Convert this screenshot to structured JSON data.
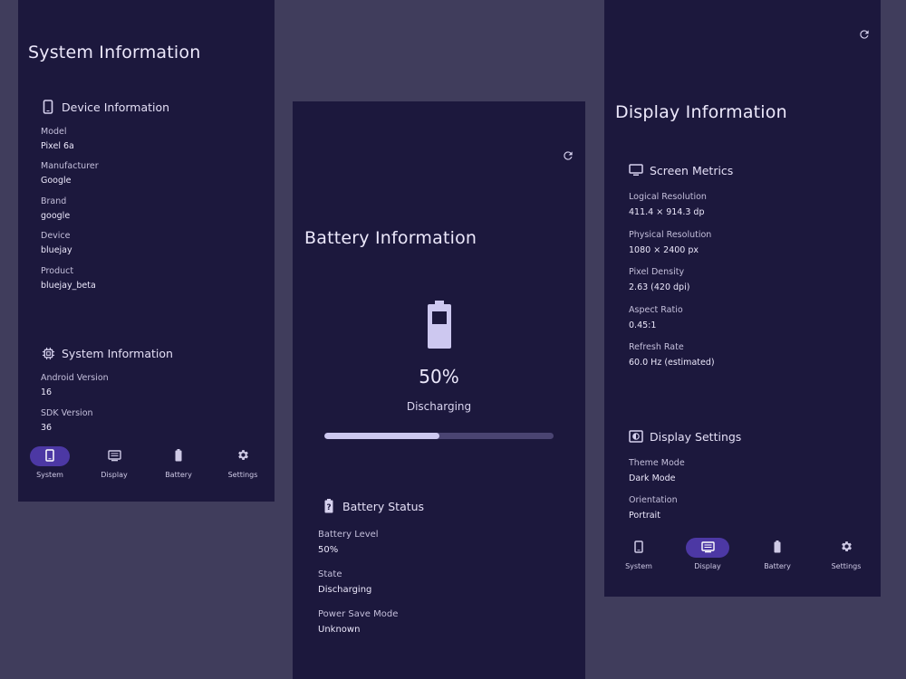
{
  "system_screen": {
    "title": "System Information",
    "device_section": {
      "title": "Device Information",
      "icon": "phone-icon",
      "fields": [
        {
          "label": "Model",
          "value": "Pixel 6a"
        },
        {
          "label": "Manufacturer",
          "value": "Google"
        },
        {
          "label": "Brand",
          "value": "google"
        },
        {
          "label": "Device",
          "value": "bluejay"
        },
        {
          "label": "Product",
          "value": "bluejay_beta"
        }
      ]
    },
    "system_section": {
      "title": "System Information",
      "icon": "chip-icon",
      "fields": [
        {
          "label": "Android Version",
          "value": "16"
        },
        {
          "label": "SDK Version",
          "value": "36"
        }
      ]
    },
    "nav": {
      "items": [
        {
          "label": "System",
          "icon": "phone-icon",
          "active": true
        },
        {
          "label": "Display",
          "icon": "display-icon",
          "active": false
        },
        {
          "label": "Battery",
          "icon": "battery-icon",
          "active": false
        },
        {
          "label": "Settings",
          "icon": "gear-icon",
          "active": false
        }
      ]
    }
  },
  "battery_screen": {
    "title": "Battery Information",
    "refresh_icon": "refresh-icon",
    "level_text": "50%",
    "level_fraction": 0.5,
    "state_text": "Discharging",
    "status_section": {
      "title": "Battery Status",
      "icon": "battery-unknown-icon",
      "fields": [
        {
          "label": "Battery Level",
          "value": "50%"
        },
        {
          "label": "State",
          "value": "Discharging"
        },
        {
          "label": "Power Save Mode",
          "value": "Unknown"
        }
      ]
    }
  },
  "display_screen": {
    "title": "Display Information",
    "refresh_icon": "refresh-icon",
    "metrics_section": {
      "title": "Screen Metrics",
      "icon": "monitor-icon",
      "fields": [
        {
          "label": "Logical Resolution",
          "value": "411.4 × 914.3 dp"
        },
        {
          "label": "Physical Resolution",
          "value": "1080 × 2400 px"
        },
        {
          "label": "Pixel Density",
          "value": "2.63 (420 dpi)"
        },
        {
          "label": "Aspect Ratio",
          "value": "0.45:1"
        },
        {
          "label": "Refresh Rate",
          "value": "60.0 Hz (estimated)"
        }
      ]
    },
    "settings_section": {
      "title": "Display Settings",
      "icon": "brightness-icon",
      "fields": [
        {
          "label": "Theme Mode",
          "value": "Dark Mode"
        },
        {
          "label": "Orientation",
          "value": "Portrait"
        }
      ]
    },
    "nav": {
      "items": [
        {
          "label": "System",
          "icon": "phone-icon",
          "active": false
        },
        {
          "label": "Display",
          "icon": "display-icon",
          "active": true
        },
        {
          "label": "Battery",
          "icon": "battery-icon",
          "active": false
        },
        {
          "label": "Settings",
          "icon": "gear-icon",
          "active": false
        }
      ]
    }
  },
  "colors": {
    "page_background": "#403d5c",
    "screen_background": "#1c183d",
    "active_pill": "#4c38a4",
    "progress_fill": "#cdc8f0",
    "progress_track": "#4a4472"
  }
}
